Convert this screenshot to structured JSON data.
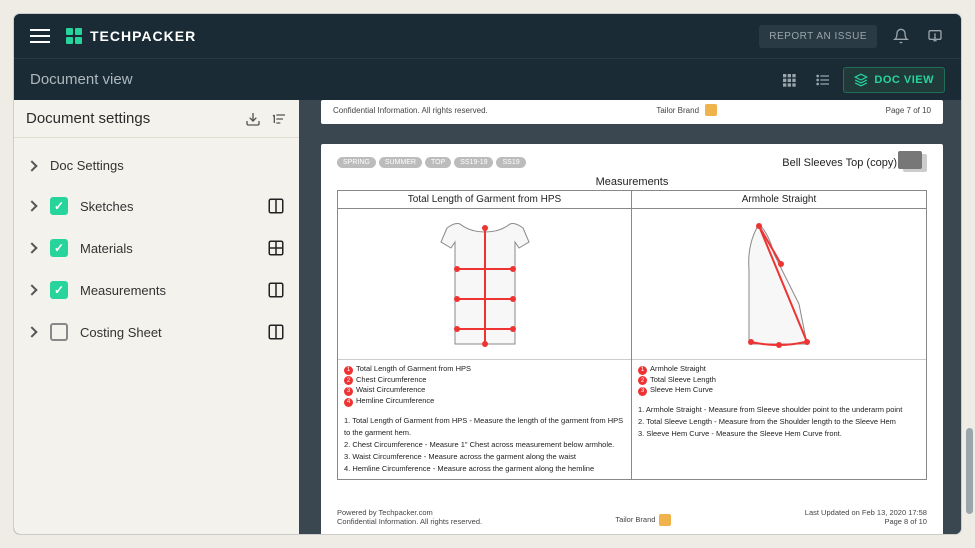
{
  "brand": "TECHPACKER",
  "topbar": {
    "report_label": "REPORT AN ISSUE"
  },
  "subbar": {
    "title": "Document view",
    "docview_label": "DOC VIEW"
  },
  "sidebar": {
    "title": "Document settings",
    "items": [
      {
        "label": "Doc Settings",
        "checked": null
      },
      {
        "label": "Sketches",
        "checked": true
      },
      {
        "label": "Materials",
        "checked": true
      },
      {
        "label": "Measurements",
        "checked": true
      },
      {
        "label": "Costing Sheet",
        "checked": false
      }
    ]
  },
  "page_stub": {
    "left_text": "Confidential Information. All rights reserved.",
    "brand_label": "Tailor Brand",
    "page_text": "Page 7 of 10"
  },
  "page": {
    "tags": [
      "SPRING",
      "SUMMER",
      "TOP",
      "SS19-19",
      "SS19"
    ],
    "title_right": "Bell Sleeves Top (copy)",
    "section_title": "Measurements",
    "cells": [
      {
        "title": "Total Length of Garment from HPS",
        "legend": [
          "Total Length of Garment from HPS",
          "Chest Circumference",
          "Waist Circumference",
          "Hemline Circumference"
        ],
        "notes": [
          "1. Total Length of Garment from HPS - Measure the length of the garment from HPS to the garment hem.",
          "2. Chest Circumference - Measure 1\" Chest across measurement below armhole.",
          "3. Waist Circumference - Measure across the garment along the waist",
          "4. Hemline Circumference - Measure across the garment along the hemline"
        ]
      },
      {
        "title": "Armhole Straight",
        "legend": [
          "Armhole Straight",
          "Total Sleeve Length",
          "Sleeve Hem Curve"
        ],
        "notes": [
          "1. Armhole Straight - Measure from Sleeve shoulder point to the underarm point",
          "2. Total Sleeve Length - Measure from the Shoulder length to the Sleeve Hem",
          "3. Sleeve Hem Curve - Measure the Sleeve Hem Curve front."
        ]
      }
    ],
    "footer": {
      "powered": "Powered by Techpacker.com",
      "confidential": "Confidential Information. All rights reserved.",
      "brand_label": "Tailor Brand",
      "updated": "Last Updated on Feb 13, 2020 17:58",
      "page_text": "Page 8 of 10"
    }
  }
}
